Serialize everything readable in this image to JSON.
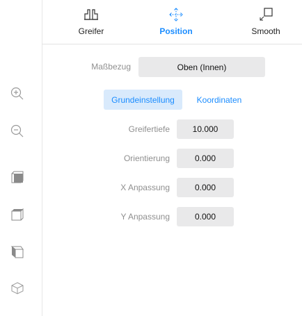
{
  "tabs": [
    {
      "label": "Greifer",
      "icon": "gripper-icon",
      "active": false
    },
    {
      "label": "Position",
      "icon": "move-arrows-icon",
      "active": true
    },
    {
      "label": "Smooth",
      "icon": "expand-corner-icon",
      "active": false
    }
  ],
  "reference": {
    "label": "Maßbezug",
    "value": "Oben (Innen)"
  },
  "segments": {
    "basic": "Grundeinstellung",
    "coords": "Koordinaten",
    "selected": "Grundeinstellung"
  },
  "fields": [
    {
      "label": "Greifertiefe",
      "value": "10.000"
    },
    {
      "label": "Orientierung",
      "value": "0.000"
    },
    {
      "label": "X Anpassung",
      "value": "0.000"
    },
    {
      "label": "Y Anpassung",
      "value": "0.000"
    }
  ],
  "leftbar": [
    "zoom-in-icon",
    "zoom-out-icon",
    "cube-front-view-icon",
    "cube-top-view-icon",
    "cube-side-view-icon",
    "cube-iso-view-icon"
  ],
  "colors": {
    "accent": "#1a8cff",
    "field_bg": "#e9e9ea",
    "segment_active_bg": "#d9eafc",
    "label_gray": "#8f8f8f"
  }
}
